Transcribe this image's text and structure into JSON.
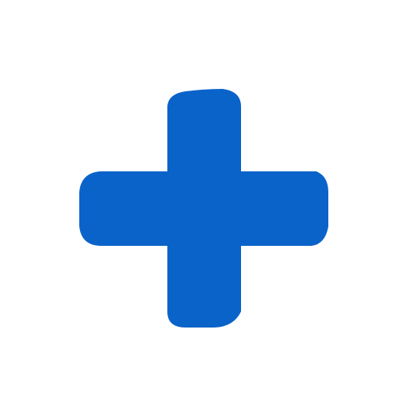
{
  "icon": {
    "name": "plus-icon",
    "color": "#0a63c9"
  }
}
